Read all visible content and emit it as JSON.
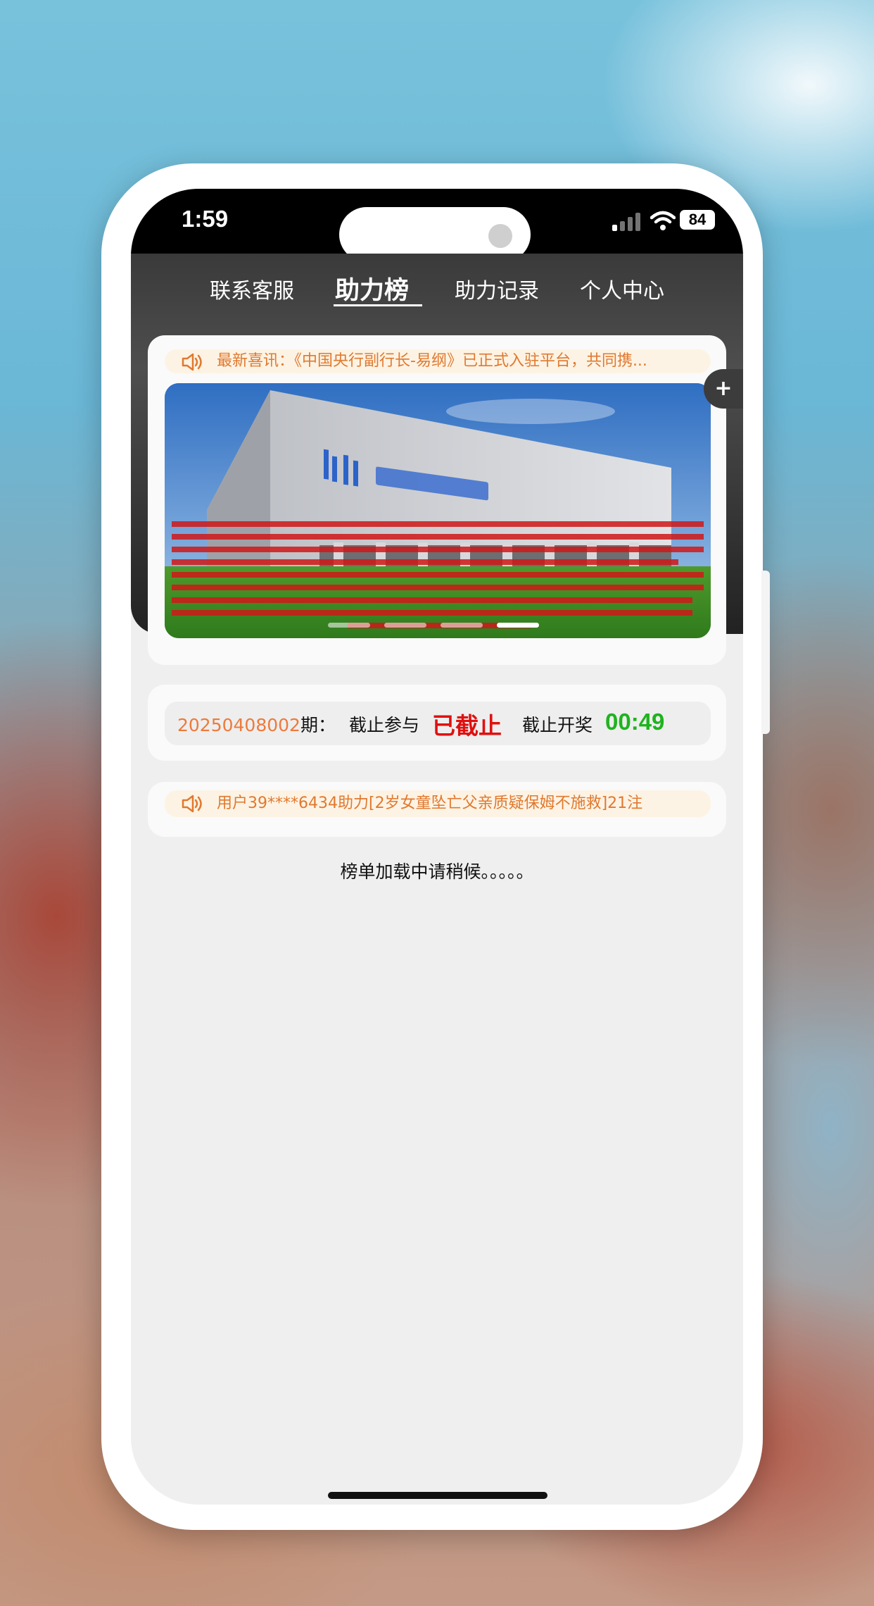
{
  "status_bar": {
    "time": "1:59",
    "battery": "84"
  },
  "tabs": [
    {
      "label": "联系客服",
      "active": false
    },
    {
      "label": "助力榜",
      "active": true
    },
    {
      "label": "助力记录",
      "active": false
    },
    {
      "label": "个人中心",
      "active": false
    }
  ],
  "announcement": {
    "icon": "speaker-icon",
    "text": "最新喜讯：《中国央行副行长-易纲》已正式入驻平台，共同携..."
  },
  "banner": {
    "slide_count": 4,
    "active_slide": 4
  },
  "floating_button": {
    "icon": "plus-icon",
    "label": "+"
  },
  "issue": {
    "number": "20250408002",
    "number_suffix": "期：",
    "participation_label": "截止参与",
    "participation_status": "已截止",
    "draw_label": "截止开奖",
    "countdown": "00:49",
    "status_color": "#e01010",
    "countdown_color": "#1fb31f"
  },
  "activity_feed": {
    "icon": "speaker-icon",
    "text": "用户39****6434助力[2岁女童坠亡父亲质疑保姆不施救]21注"
  },
  "ranking": {
    "loading_text": "榜单加载中请稍候。。。。。"
  },
  "colors": {
    "accent_orange": "#e0792f",
    "header_dark": "#3a3a3a"
  }
}
